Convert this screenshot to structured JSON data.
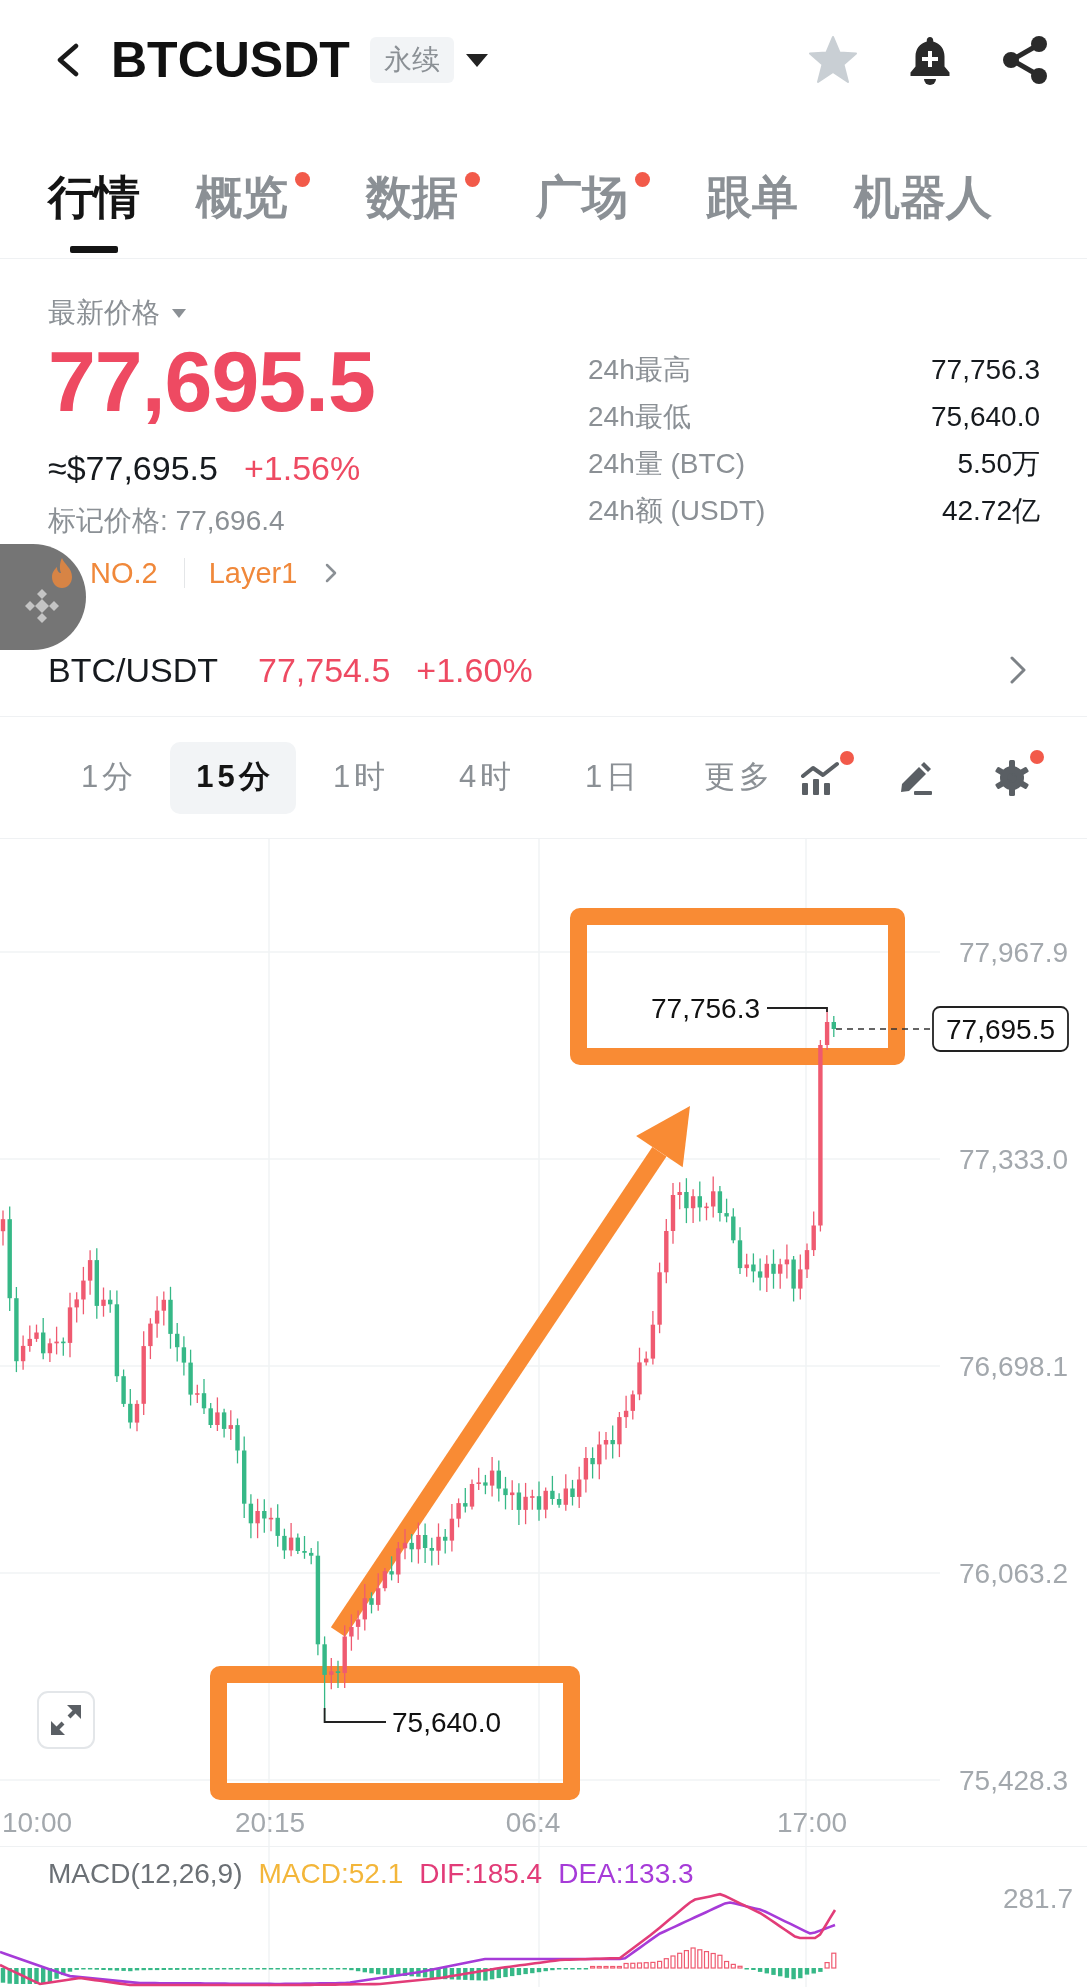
{
  "header": {
    "symbol": "BTCUSDT",
    "contract_tag": "永续"
  },
  "tabs": [
    {
      "label": "行情",
      "selected": true,
      "badge": false
    },
    {
      "label": "概览",
      "selected": false,
      "badge": true
    },
    {
      "label": "数据",
      "selected": false,
      "badge": true
    },
    {
      "label": "广场",
      "selected": false,
      "badge": true
    },
    {
      "label": "跟单",
      "selected": false,
      "badge": false
    },
    {
      "label": "机器人",
      "selected": false,
      "badge": false
    }
  ],
  "price_panel": {
    "label": "最新价格",
    "last_price": "77,695.5",
    "usd_value": "≈$77,695.5",
    "change": "+1.56%",
    "mark_price": "标记价格: 77,696.4",
    "rank": "NO.2",
    "sector": "Layer1"
  },
  "stats": [
    {
      "label": "24h最高",
      "value": "77,756.3"
    },
    {
      "label": "24h最低",
      "value": "75,640.0"
    },
    {
      "label": "24h量 (BTC)",
      "value": "5.50万"
    },
    {
      "label": "24h额 (USDT)",
      "value": "42.72亿"
    }
  ],
  "spot": {
    "pair": "BTC/USDT",
    "price": "77,754.5",
    "change": "+1.60%"
  },
  "intervals": [
    {
      "label": "1分",
      "selected": false
    },
    {
      "label": "15分",
      "selected": true
    },
    {
      "label": "1时",
      "selected": false
    },
    {
      "label": "4时",
      "selected": false
    },
    {
      "label": "1日",
      "selected": false
    },
    {
      "label": "更多",
      "selected": false
    }
  ],
  "tools": [
    {
      "kind": "indicators",
      "badge": true
    },
    {
      "kind": "drawing",
      "badge": false
    },
    {
      "kind": "settings",
      "badge": true
    }
  ],
  "chart": {
    "price_axis": [
      "77,967.9",
      "77,333.0",
      "76,698.1",
      "76,063.2",
      "75,428.3"
    ],
    "time_axis": [
      "10:00",
      "20:15",
      "06:4",
      "17:00"
    ],
    "high_label": "77,756.3",
    "low_label": "75,640.0",
    "last_price_tag": "77,695.5"
  },
  "macd": {
    "title": "MACD(12,26,9)",
    "legend": [
      {
        "text": "MACD:52.1",
        "color": "#f3b63a"
      },
      {
        "text": "DIF:185.4",
        "color": "#e23c78"
      },
      {
        "text": "DEA:133.3",
        "color": "#a63bd8"
      }
    ],
    "axis_label": "281.7"
  }
}
